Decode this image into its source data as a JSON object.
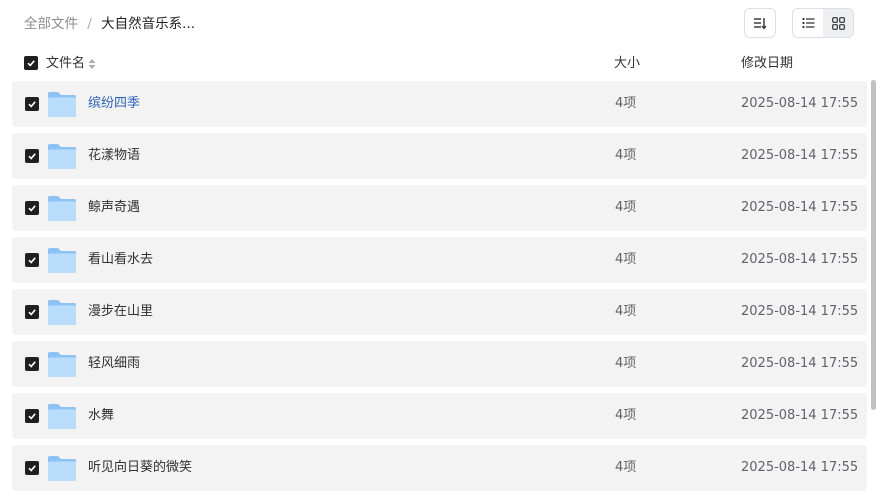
{
  "breadcrumb": {
    "root": "全部文件",
    "separator": "/",
    "current": "大自然音乐系..."
  },
  "toolbar": {
    "sort_icon": "sort-icon",
    "list_view_icon": "list-view-icon",
    "grid_view_icon": "grid-view-icon"
  },
  "table": {
    "headers": {
      "name": "文件名",
      "size": "大小",
      "modified": "修改日期"
    },
    "rows": [
      {
        "name": "缤纷四季",
        "size": "4项",
        "modified": "2025-08-14 17:55"
      },
      {
        "name": "花漾物语",
        "size": "4项",
        "modified": "2025-08-14 17:55"
      },
      {
        "name": "鲸声奇遇",
        "size": "4项",
        "modified": "2025-08-14 17:55"
      },
      {
        "name": "看山看水去",
        "size": "4项",
        "modified": "2025-08-14 17:55"
      },
      {
        "name": "漫步在山里",
        "size": "4项",
        "modified": "2025-08-14 17:55"
      },
      {
        "name": "轻风细雨",
        "size": "4项",
        "modified": "2025-08-14 17:55"
      },
      {
        "name": "水舞",
        "size": "4项",
        "modified": "2025-08-14 17:55"
      },
      {
        "name": "听见向日葵的微笑",
        "size": "4项",
        "modified": "2025-08-14 17:55"
      }
    ]
  },
  "colors": {
    "row_bg": "#f3f3f3",
    "checkbox": "#1f1f1f",
    "folder_back": "#8ec2f5",
    "folder_front": "#b9dcfb",
    "link": "#2f63b8"
  }
}
